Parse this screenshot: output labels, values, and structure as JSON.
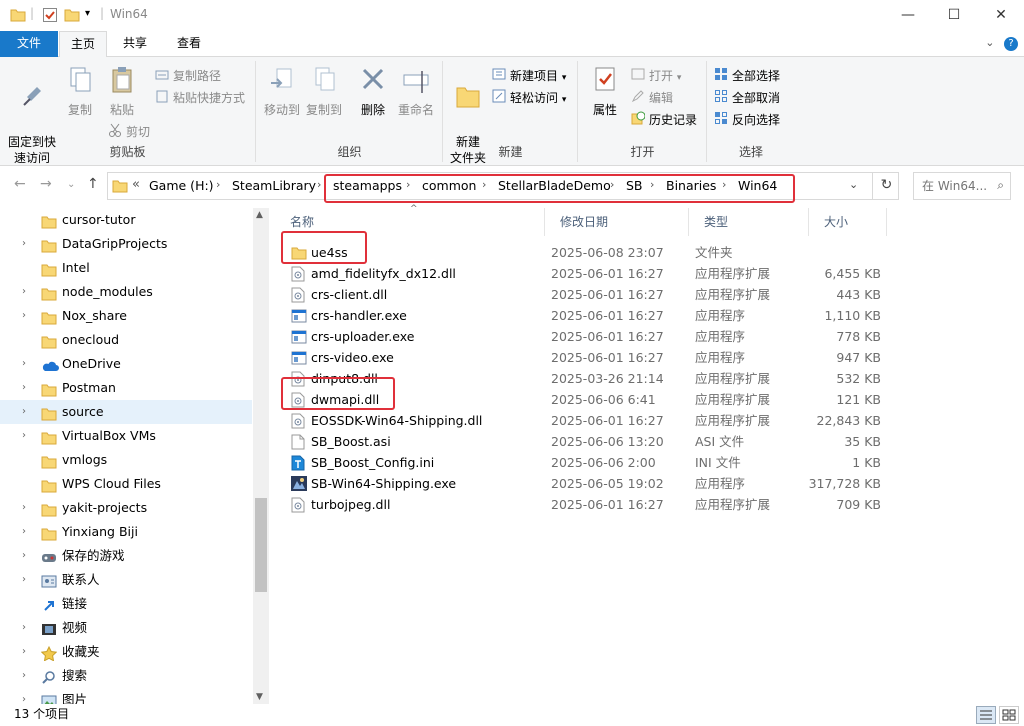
{
  "window": {
    "title": "Win64",
    "minimize": "—",
    "maximize": "☐",
    "close": "✕"
  },
  "tabs": {
    "file": "文件",
    "home": "主页",
    "share": "共享",
    "view": "查看"
  },
  "ribbon": {
    "clipboard": {
      "label": "剪贴板",
      "pin": "固定到快\n速访问",
      "copy": "复制",
      "paste": "粘贴",
      "copy_path": "复制路径",
      "paste_shortcut": "粘贴快捷方式",
      "cut": "剪切"
    },
    "organize": {
      "label": "组织",
      "move_to": "移动到",
      "copy_to": "复制到",
      "delete": "删除",
      "rename": "重命名"
    },
    "new": {
      "label": "新建",
      "new_folder": "新建\n文件夹",
      "new_item": "新建项目",
      "easy_access": "轻松访问"
    },
    "open": {
      "label": "打开",
      "properties": "属性",
      "open": "打开",
      "edit": "编辑",
      "history": "历史记录"
    },
    "select": {
      "label": "选择",
      "select_all": "全部选择",
      "select_none": "全部取消",
      "invert": "反向选择"
    }
  },
  "address": {
    "overflow": "«",
    "crumbs": [
      "Game (H:)",
      "SteamLibrary",
      "steamapps",
      "common",
      "StellarBladeDemo",
      "SB",
      "Binaries",
      "Win64"
    ],
    "search_placeholder": "在 Win64..."
  },
  "nav": {
    "items": [
      {
        "label": "cursor-tutor",
        "icon": "folder-icon",
        "chevron": false
      },
      {
        "label": "DataGripProjects",
        "icon": "folder-icon",
        "chevron": true
      },
      {
        "label": "Intel",
        "icon": "folder-icon",
        "chevron": false
      },
      {
        "label": "node_modules",
        "icon": "folder-icon",
        "chevron": true
      },
      {
        "label": "Nox_share",
        "icon": "folder-icon",
        "chevron": true
      },
      {
        "label": "onecloud",
        "icon": "folder-icon",
        "chevron": false
      },
      {
        "label": "OneDrive",
        "icon": "cloud-icon",
        "chevron": true
      },
      {
        "label": "Postman",
        "icon": "folder-icon",
        "chevron": true
      },
      {
        "label": "source",
        "icon": "folder-icon",
        "chevron": true,
        "selected": true
      },
      {
        "label": "VirtualBox VMs",
        "icon": "folder-icon",
        "chevron": true
      },
      {
        "label": "vmlogs",
        "icon": "folder-icon",
        "chevron": false
      },
      {
        "label": "WPS Cloud Files",
        "icon": "folder-icon",
        "chevron": false
      },
      {
        "label": "yakit-projects",
        "icon": "folder-icon",
        "chevron": true
      },
      {
        "label": "Yinxiang Biji",
        "icon": "folder-icon",
        "chevron": true
      },
      {
        "label": "保存的游戏",
        "icon": "saved-games-icon",
        "chevron": true
      },
      {
        "label": "联系人",
        "icon": "contacts-icon",
        "chevron": true
      },
      {
        "label": "链接",
        "icon": "links-icon",
        "chevron": false
      },
      {
        "label": "视频",
        "icon": "videos-icon",
        "chevron": true
      },
      {
        "label": "收藏夹",
        "icon": "favorites-icon",
        "chevron": true
      },
      {
        "label": "搜索",
        "icon": "search-icon",
        "chevron": true
      },
      {
        "label": "图片",
        "icon": "pictures-icon",
        "chevron": true
      }
    ]
  },
  "columns": {
    "name": "名称",
    "date": "修改日期",
    "type": "类型",
    "size": "大小"
  },
  "files": [
    {
      "name": "ue4ss",
      "date": "2025-06-08 23:07",
      "type": "文件夹",
      "size": "",
      "icon": "folder-icon"
    },
    {
      "name": "amd_fidelityfx_dx12.dll",
      "date": "2025-06-01 16:27",
      "type": "应用程序扩展",
      "size": "6,455 KB",
      "icon": "dll-icon"
    },
    {
      "name": "crs-client.dll",
      "date": "2025-06-01 16:27",
      "type": "应用程序扩展",
      "size": "443 KB",
      "icon": "dll-icon"
    },
    {
      "name": "crs-handler.exe",
      "date": "2025-06-01 16:27",
      "type": "应用程序",
      "size": "1,110 KB",
      "icon": "exe-icon"
    },
    {
      "name": "crs-uploader.exe",
      "date": "2025-06-01 16:27",
      "type": "应用程序",
      "size": "778 KB",
      "icon": "exe-icon"
    },
    {
      "name": "crs-video.exe",
      "date": "2025-06-01 16:27",
      "type": "应用程序",
      "size": "947 KB",
      "icon": "exe-icon"
    },
    {
      "name": "dinput8.dll",
      "date": "2025-03-26 21:14",
      "type": "应用程序扩展",
      "size": "532 KB",
      "icon": "dll-icon"
    },
    {
      "name": "dwmapi.dll",
      "date": "2025-06-06 6:41",
      "type": "应用程序扩展",
      "size": "121 KB",
      "icon": "dll-icon"
    },
    {
      "name": "EOSSDK-Win64-Shipping.dll",
      "date": "2025-06-01 16:27",
      "type": "应用程序扩展",
      "size": "22,843 KB",
      "icon": "dll-icon"
    },
    {
      "name": "SB_Boost.asi",
      "date": "2025-06-06 13:20",
      "type": "ASI 文件",
      "size": "35 KB",
      "icon": "file-icon"
    },
    {
      "name": "SB_Boost_Config.ini",
      "date": "2025-06-06 2:00",
      "type": "INI 文件",
      "size": "1 KB",
      "icon": "ini-icon"
    },
    {
      "name": "SB-Win64-Shipping.exe",
      "date": "2025-06-05 19:02",
      "type": "应用程序",
      "size": "317,728 KB",
      "icon": "game-exe-icon"
    },
    {
      "name": "turbojpeg.dll",
      "date": "2025-06-01 16:27",
      "type": "应用程序扩展",
      "size": "709 KB",
      "icon": "dll-icon"
    }
  ],
  "status": {
    "count": "13 个项目"
  },
  "colors": {
    "file_tab": "#1979ca",
    "selection": "#e5f1fb",
    "highlight": "#e0303a",
    "folder": "#f8d775"
  }
}
